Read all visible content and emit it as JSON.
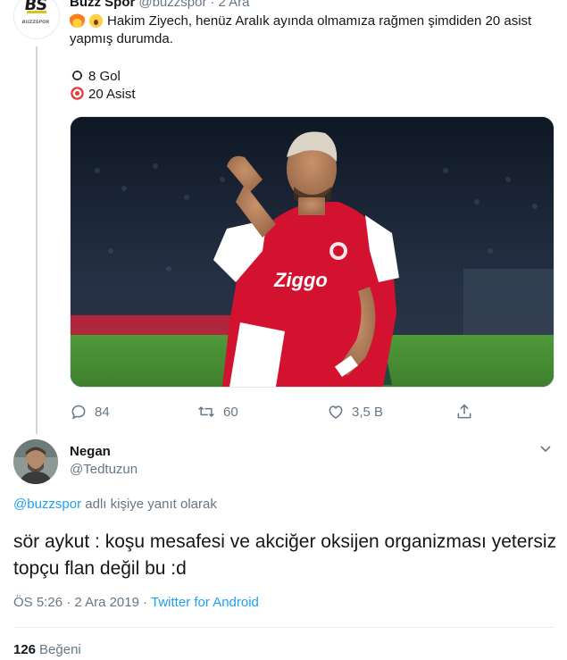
{
  "original_tweet": {
    "author_name": "Buzz Spor",
    "author_handle": "@buzzspor",
    "separator": "·",
    "time": "2 Ara",
    "text": "Hakim Ziyech, henüz Aralık ayında olmamıza rağmen şimdiden 20 asist yapmış durumda.",
    "stat_goals": "8 Gol",
    "stat_assists": "20 Asist",
    "avatar_text": "BS",
    "avatar_subtext": "BUZZSPOR",
    "actions": {
      "replies": "84",
      "retweets": "60",
      "likes": "3,5 B"
    },
    "icons": [
      "fire-icon",
      "scream-icon",
      "soccer-ball-icon",
      "target-icon",
      "reply-icon",
      "retweet-icon",
      "like-icon",
      "share-icon"
    ]
  },
  "reply_tweet": {
    "author_name": "Negan",
    "author_handle": "@Tedtuzun",
    "replying_to_link": "@buzzspor",
    "replying_to_suffix": " adlı kişiye yanıt olarak",
    "text": "sör aykut : koşu mesafesi ve akciğer oksijen organizması yetersiz topçu flan değil bu :d",
    "time": "ÖS 5:26",
    "date": "2 Ara 2019",
    "meta_separator": " · ",
    "source": "Twitter for Android",
    "likes_count": "126",
    "likes_label": "Beğeni"
  },
  "colors": {
    "link": "#1da1f2",
    "secondary_text": "#657786",
    "primary_text": "#14171a",
    "thread_line": "#ccd6dd",
    "jersey_red": "#d2122e"
  }
}
